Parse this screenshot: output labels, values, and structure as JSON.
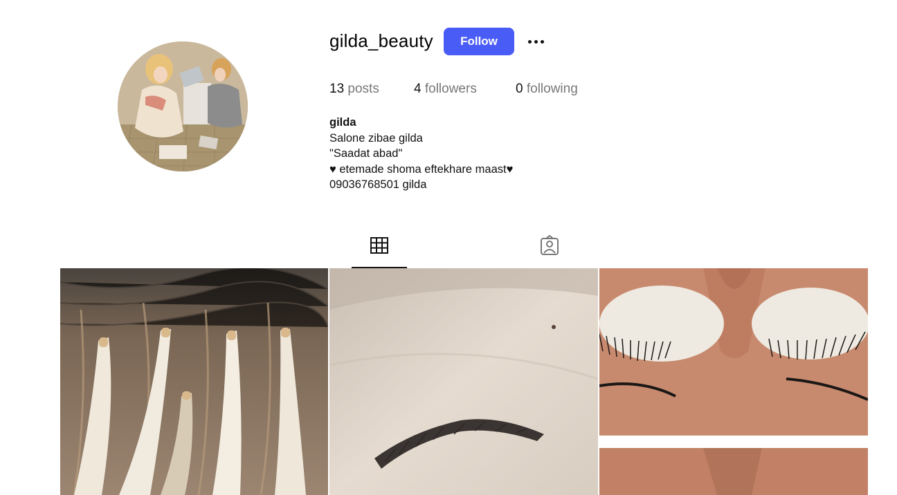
{
  "profile": {
    "username": "gilda_beauty",
    "follow_label": "Follow",
    "more_icon": "more-horizontal-icon",
    "avatar_alt": "profile-picture",
    "stats": {
      "posts_count": "13",
      "posts_label": "posts",
      "followers_count": "4",
      "followers_label": "followers",
      "following_count": "0",
      "following_label": "following"
    },
    "bio": {
      "name": "gilda",
      "lines": [
        "Salone zibae gilda",
        "\"Saadat abad\"",
        "♥ etemade shoma eftekhare maast♥",
        "09036768501 gilda"
      ]
    }
  },
  "tabs": [
    {
      "name": "posts-grid",
      "icon": "grid-icon",
      "active": true
    },
    {
      "name": "tagged",
      "icon": "tagged-user-icon",
      "active": false
    }
  ],
  "posts": [
    {
      "name": "post-hair-extensions"
    },
    {
      "name": "post-eyebrow"
    },
    {
      "name": "post-eyelashes"
    }
  ],
  "colors": {
    "accent": "#4a5cf6",
    "muted_text": "#777777",
    "text": "#111111"
  }
}
